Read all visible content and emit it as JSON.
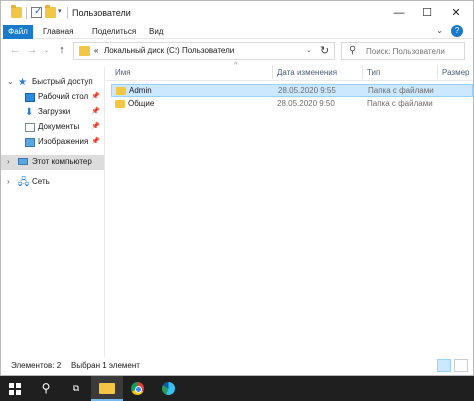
{
  "window": {
    "title": "Пользователи",
    "minimize": "—",
    "maximize": "☐",
    "close": "✕"
  },
  "ribbon": {
    "tabs": [
      "Файл",
      "Главная",
      "Поделиться",
      "Вид"
    ],
    "expand": "⌄",
    "help": "?"
  },
  "nav": {
    "back": "←",
    "forward": "→",
    "recent": "⌄",
    "up": "↑",
    "path_prefix": "«",
    "path": [
      "Локальный диск (C:)",
      "Пользователи"
    ],
    "path_sep": "›",
    "path_drop": "⌄",
    "refresh": "↻",
    "search_placeholder": "Поиск: Пользователи"
  },
  "navpane": {
    "quick_access": "Быстрый доступ",
    "items": [
      {
        "label": "Рабочий стол",
        "icon": "desktop-icon"
      },
      {
        "label": "Загрузки",
        "icon": "downloads-icon"
      },
      {
        "label": "Документы",
        "icon": "documents-icon"
      },
      {
        "label": "Изображения",
        "icon": "pictures-icon"
      }
    ],
    "this_pc": "Этот компьютер",
    "network": "Сеть"
  },
  "list": {
    "columns": [
      "Имя",
      "Дата изменения",
      "Тип",
      "Размер"
    ],
    "rows": [
      {
        "name": "Admin",
        "date": "28.05.2020 9:55",
        "type": "Папка с файлами",
        "selected": true
      },
      {
        "name": "Общие",
        "date": "28.05.2020 9:50",
        "type": "Папка с файлами",
        "selected": false
      }
    ]
  },
  "status": {
    "count": "Элементов: 2",
    "selected": "Выбран 1 элемент"
  },
  "colors": {
    "accent": "#1979ca",
    "selection": "#cce8ff",
    "folder": "#f3c743",
    "taskbar": "#1f1f1f"
  }
}
